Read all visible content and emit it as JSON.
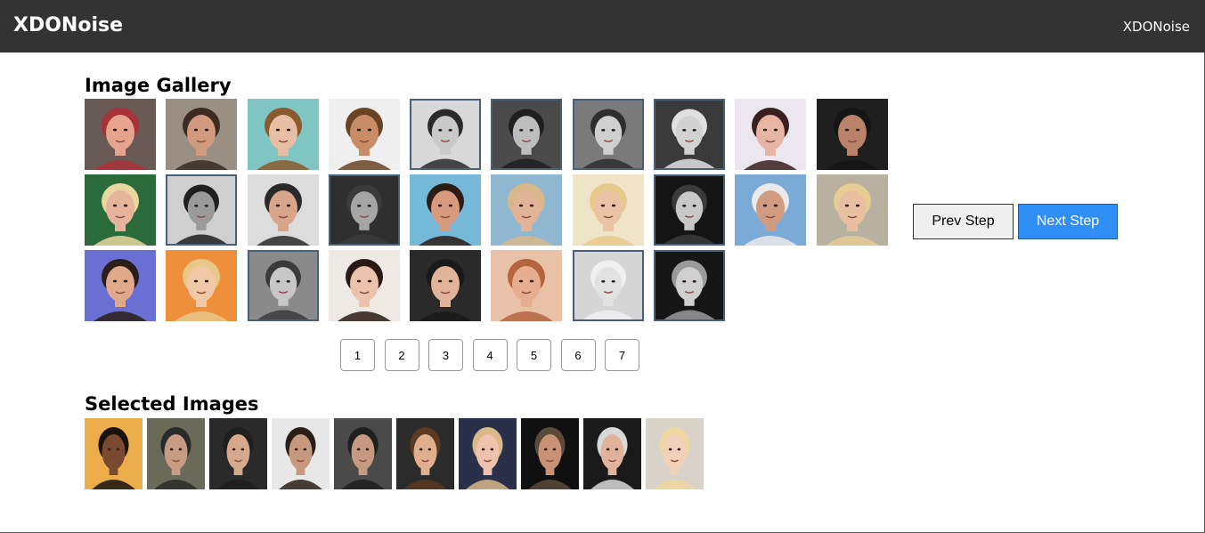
{
  "navbar": {
    "brand": "XDONoise",
    "link": "XDONoise"
  },
  "gallery": {
    "title": "Image Gallery",
    "images": [
      {
        "bg": "#6a5a55",
        "skin": "#e6a48f",
        "hair": "#a8323a",
        "selected": false
      },
      {
        "bg": "#9a8f85",
        "skin": "#d19a7e",
        "hair": "#3b2b22",
        "selected": false
      },
      {
        "bg": "#7fc5c2",
        "skin": "#e8bfa4",
        "hair": "#8a5a2e",
        "selected": false
      },
      {
        "bg": "#efefef",
        "skin": "#c68d67",
        "hair": "#6a4326",
        "selected": false
      },
      {
        "bg": "#d8d8d8",
        "skin": "#c9c9c9",
        "hair": "#2a2a2a",
        "selected": true
      },
      {
        "bg": "#4a4a4a",
        "skin": "#bdbdbd",
        "hair": "#1f1f1f",
        "selected": true
      },
      {
        "bg": "#7a7a7a",
        "skin": "#cfcfcf",
        "hair": "#2e2e2e",
        "selected": true
      },
      {
        "bg": "#3a3a3a",
        "skin": "#d2d2d2",
        "hair": "#e0e0e0",
        "selected": true
      },
      {
        "bg": "#ece6ef",
        "skin": "#e7b5a3",
        "hair": "#3a1f1f",
        "selected": false
      },
      {
        "bg": "#1f1f1f",
        "skin": "#b9836a",
        "hair": "#151515",
        "selected": false
      },
      {
        "bg": "#2b6a3a",
        "skin": "#e6b49b",
        "hair": "#e9d7a1",
        "selected": false
      },
      {
        "bg": "#cfcfcf",
        "skin": "#9a9a9a",
        "hair": "#1f1f1f",
        "selected": true
      },
      {
        "bg": "#dcdcdc",
        "skin": "#d8a58a",
        "hair": "#2a2a2a",
        "selected": false
      },
      {
        "bg": "#2f2f2f",
        "skin": "#a5a5a5",
        "hair": "#3b3b3b",
        "selected": true
      },
      {
        "bg": "#76b8d8",
        "skin": "#d79a7d",
        "hair": "#2c1c16",
        "selected": false
      },
      {
        "bg": "#8fb7cf",
        "skin": "#e2b497",
        "hair": "#d7b88a",
        "selected": false
      },
      {
        "bg": "#efe3c8",
        "skin": "#e9c4a4",
        "hair": "#e7c98c",
        "selected": false
      },
      {
        "bg": "#141414",
        "skin": "#c8c8c8",
        "hair": "#3a3a3a",
        "selected": true
      },
      {
        "bg": "#7caad6",
        "skin": "#d19b82",
        "hair": "#eaeaea",
        "selected": false
      },
      {
        "bg": "#b9b19f",
        "skin": "#e8c0a0",
        "hair": "#e5cd94",
        "selected": false
      },
      {
        "bg": "#6a6fd4",
        "skin": "#e1a98c",
        "hair": "#2a1e18",
        "selected": false
      },
      {
        "bg": "#ee8f3c",
        "skin": "#f0c9a6",
        "hair": "#e9c786",
        "selected": false
      },
      {
        "bg": "#8a8a8a",
        "skin": "#c7c7c7",
        "hair": "#3a3a3a",
        "selected": true
      },
      {
        "bg": "#efe9e4",
        "skin": "#ebc2ad",
        "hair": "#2a1a16",
        "selected": false
      },
      {
        "bg": "#2a2a2a",
        "skin": "#e1b39a",
        "hair": "#1a1a1a",
        "selected": false
      },
      {
        "bg": "#e9c1a6",
        "skin": "#e6ae8f",
        "hair": "#b4643f",
        "selected": false
      },
      {
        "bg": "#d5d5d5",
        "skin": "#e2e2e2",
        "hair": "#f0f0f0",
        "selected": true
      },
      {
        "bg": "#161616",
        "skin": "#cfcfcf",
        "hair": "#9a9a9a",
        "selected": true
      }
    ]
  },
  "controls": {
    "prev_label": "Prev Step",
    "next_label": "Next Step"
  },
  "pagination": {
    "pages": [
      "1",
      "2",
      "3",
      "4",
      "5",
      "6",
      "7"
    ]
  },
  "selected": {
    "title": "Selected Images",
    "images": [
      {
        "bg": "#ecae4a",
        "skin": "#7a4a30",
        "hair": "#1a120f"
      },
      {
        "bg": "#6a6a5a",
        "skin": "#c69c84",
        "hair": "#2a2a2a"
      },
      {
        "bg": "#2a2a2a",
        "skin": "#d7a98c",
        "hair": "#1f1f1f"
      },
      {
        "bg": "#e8e8e8",
        "skin": "#c79a80",
        "hair": "#2a1f18"
      },
      {
        "bg": "#4a4a4a",
        "skin": "#c59a80",
        "hair": "#1f1f1f"
      },
      {
        "bg": "#2b2b2b",
        "skin": "#e0b08e",
        "hair": "#5a3a22"
      },
      {
        "bg": "#2a2f4a",
        "skin": "#efc2ad",
        "hair": "#d9b88a"
      },
      {
        "bg": "#101010",
        "skin": "#c89274",
        "hair": "#5a4a3a"
      },
      {
        "bg": "#1a1a1a",
        "skin": "#e1b39c",
        "hair": "#d8d8d8"
      },
      {
        "bg": "#d9d2c8",
        "skin": "#f0d2ba",
        "hair": "#eed7a0"
      }
    ]
  }
}
